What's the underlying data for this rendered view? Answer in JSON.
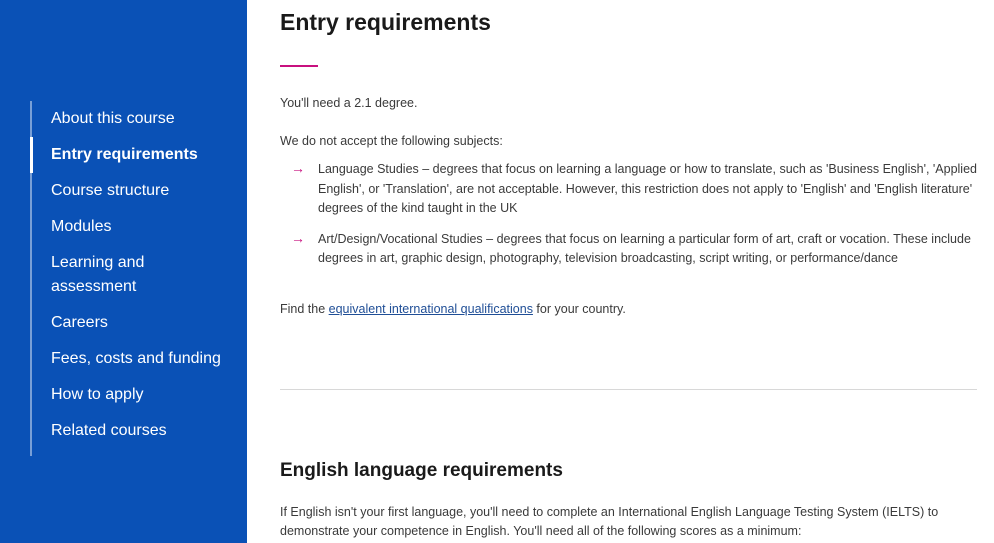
{
  "sidebar": {
    "items": [
      {
        "label": "About this course"
      },
      {
        "label": "Entry requirements"
      },
      {
        "label": "Course structure"
      },
      {
        "label": "Modules"
      },
      {
        "label": "Learning and assessment"
      },
      {
        "label": "Careers"
      },
      {
        "label": "Fees, costs and funding"
      },
      {
        "label": "How to apply"
      },
      {
        "label": "Related courses"
      }
    ],
    "active_index": 1
  },
  "colors": {
    "sidebar_bg": "#0a51b6",
    "accent": "#c8107f",
    "link": "#1f4e96"
  },
  "main": {
    "title": "Entry requirements",
    "degree_text": "You'll need a 2.1 degree.",
    "subjects_intro": "We do not accept the following subjects:",
    "excluded_subjects": [
      {
        "text": "Language Studies – degrees that focus on learning a language or how to translate, such as 'Business English', 'Applied English', or 'Translation', are not acceptable. However, this restriction does not apply to 'English' and 'English literature' degrees of the kind taught in the UK"
      },
      {
        "text": "Art/Design/Vocational Studies – degrees that focus on learning a particular form of art, craft or vocation. These include degrees in art, graphic design, photography, television broadcasting, script writing, or performance/dance"
      }
    ],
    "bullet_icon": "arrow-right-icon",
    "equivalent": {
      "prefix": "Find the ",
      "link_text": "equivalent international qualifications",
      "suffix": " for your country."
    },
    "english_title": "English language requirements",
    "english_text": "If English isn't your first language, you'll need to complete an International English Language Testing System (IELTS) to demonstrate your competence in English. You'll need all of the following scores as a minimum:"
  }
}
